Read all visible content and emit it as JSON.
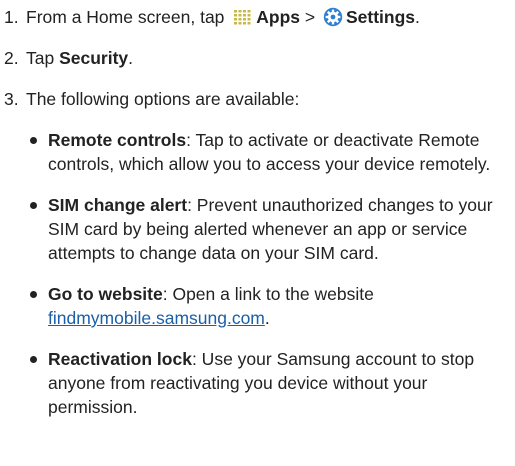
{
  "steps": [
    {
      "number": "1.",
      "prefix": "From a Home screen, tap ",
      "apps_label": "Apps",
      "separator": " > ",
      "settings_label": "Settings",
      "suffix": ".",
      "apps_icon": "apps-grid-icon",
      "settings_icon": "settings-gear-icon"
    },
    {
      "number": "2.",
      "prefix": "Tap ",
      "bold": "Security",
      "suffix": "."
    },
    {
      "number": "3.",
      "text": "The following options are available:"
    }
  ],
  "options": [
    {
      "title": "Remote controls",
      "text": ": Tap to activate or deactivate Remote controls, which allow you to access your device remotely."
    },
    {
      "title": "SIM change alert",
      "text": ": Prevent unauthorized changes to your SIM card by being alerted whenever an app or service attempts to change data on your SIM card."
    },
    {
      "title": "Go to website",
      "text": ": Open a link to the website ",
      "link": "findmymobile.samsung.com",
      "after_link": "."
    },
    {
      "title": "Reactivation lock",
      "text": ": Use your Samsung account to stop anyone from reactivating you device without your permission."
    }
  ],
  "colors": {
    "text": "#222222",
    "link": "#1a5fa8",
    "apps_icon": "#c8b84a",
    "settings_icon": "#2f7fd0"
  }
}
